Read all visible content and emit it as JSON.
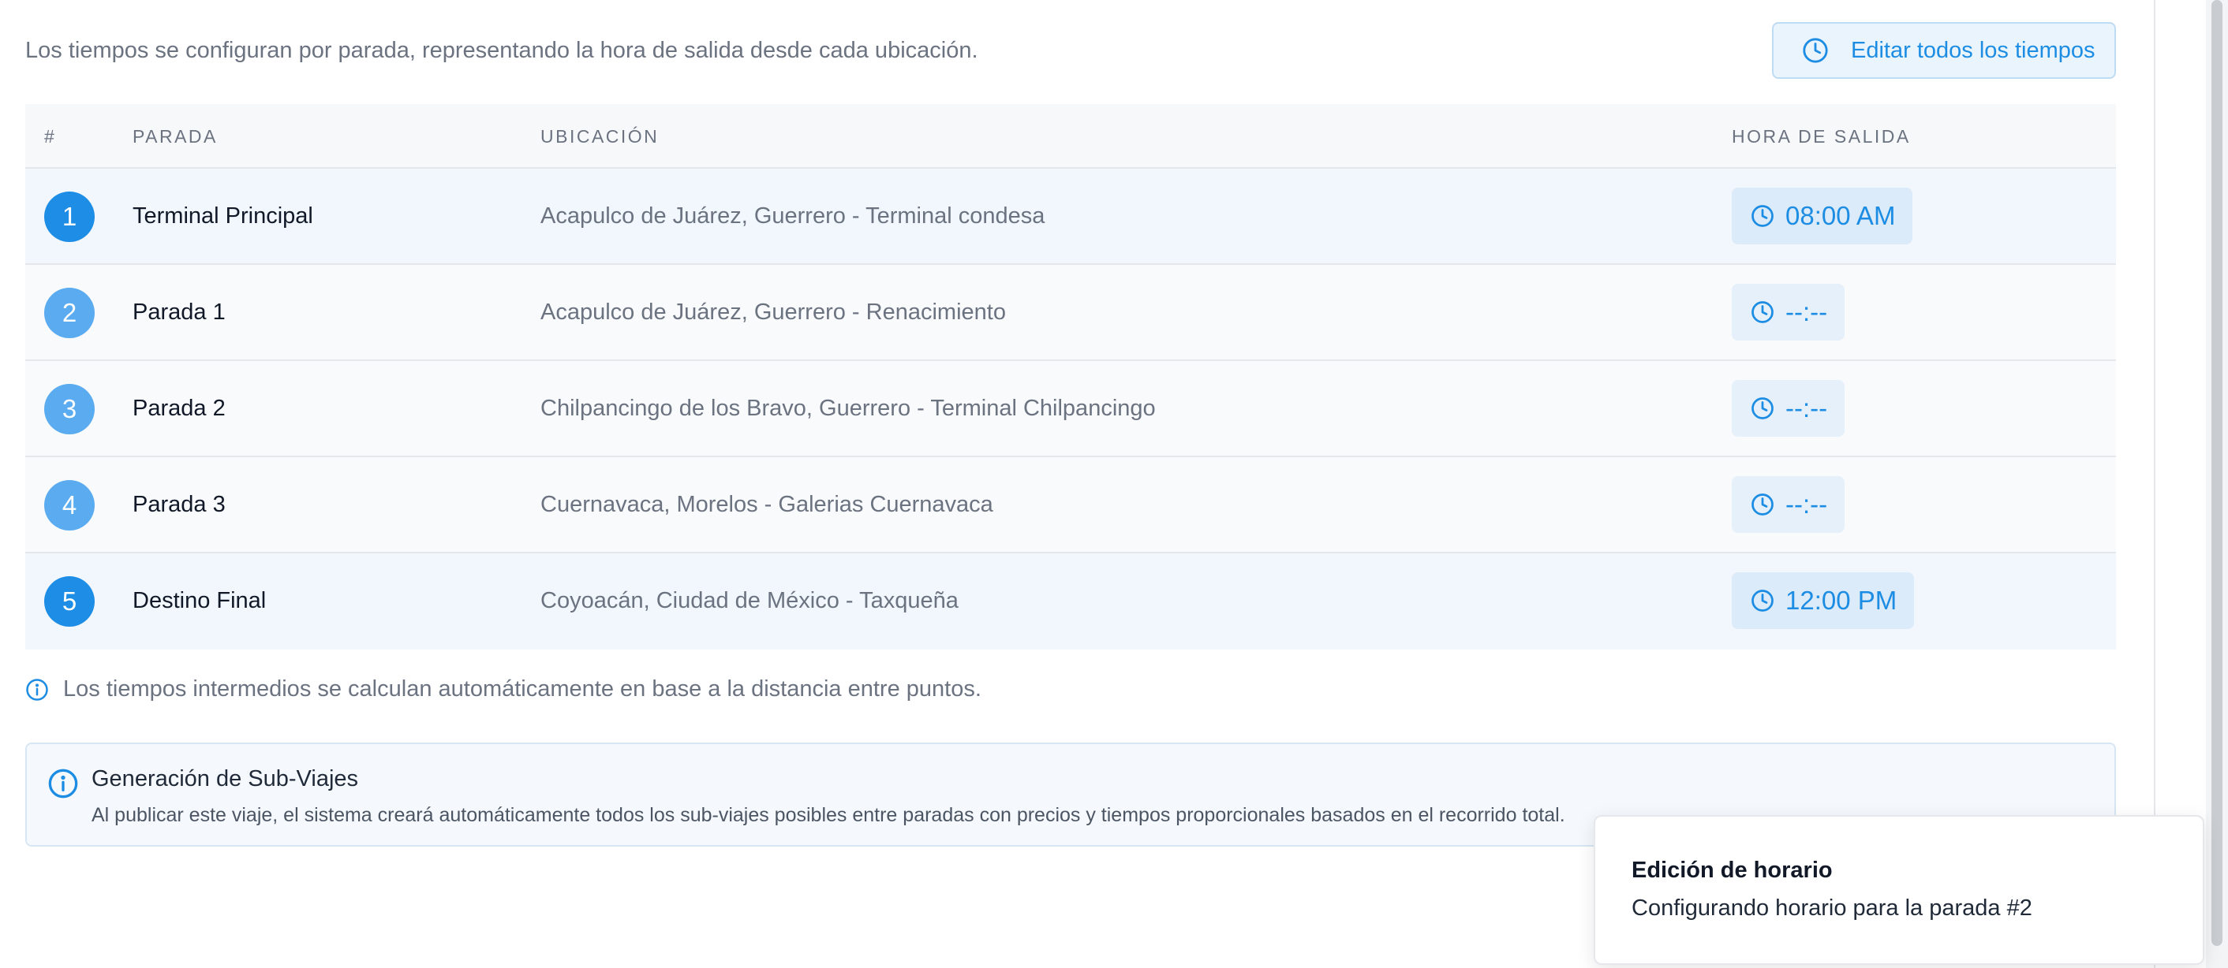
{
  "intro": {
    "description": "Los tiempos se configuran por parada, representando la hora de salida desde cada ubicación.",
    "edit_all_label": "Editar todos los tiempos"
  },
  "table": {
    "headers": {
      "num": "#",
      "stop": "PARADA",
      "location": "UBICACIÓN",
      "departure": "HORA DE SALIDA"
    },
    "rows": [
      {
        "num": "1",
        "stop": "Terminal Principal",
        "location": "Acapulco de Juárez, Guerrero - Terminal condesa",
        "time": "08:00 AM"
      },
      {
        "num": "2",
        "stop": "Parada 1",
        "location": "Acapulco de Juárez, Guerrero - Renacimiento",
        "time": "--:--"
      },
      {
        "num": "3",
        "stop": "Parada 2",
        "location": "Chilpancingo de los Bravo, Guerrero - Terminal Chilpancingo",
        "time": "--:--"
      },
      {
        "num": "4",
        "stop": "Parada 3",
        "location": "Cuernavaca, Morelos - Galerias Cuernavaca",
        "time": "--:--"
      },
      {
        "num": "5",
        "stop": "Destino Final",
        "location": "Coyoacán, Ciudad de México - Taxqueña",
        "time": "12:00 PM"
      }
    ]
  },
  "note": "Los tiempos intermedios se calculan automáticamente en base a la distancia entre puntos.",
  "info": {
    "title": "Generación de Sub-Viajes",
    "description": "Al publicar este viaje, el sistema creará automáticamente todos los sub-viajes posibles entre paradas con precios y tiempos proporcionales basados en el recorrido total."
  },
  "toast": {
    "title": "Edición de horario",
    "message": "Configurando horario para la parada #2"
  },
  "colors": {
    "accent": "#1e8de6",
    "badge_secondary": "#5aabf0",
    "chip_bg": "#dcebfa"
  },
  "icons": {
    "edit_all": "clock-icon",
    "time_chip": "clock-icon",
    "note": "info-icon",
    "info_box": "info-icon"
  }
}
